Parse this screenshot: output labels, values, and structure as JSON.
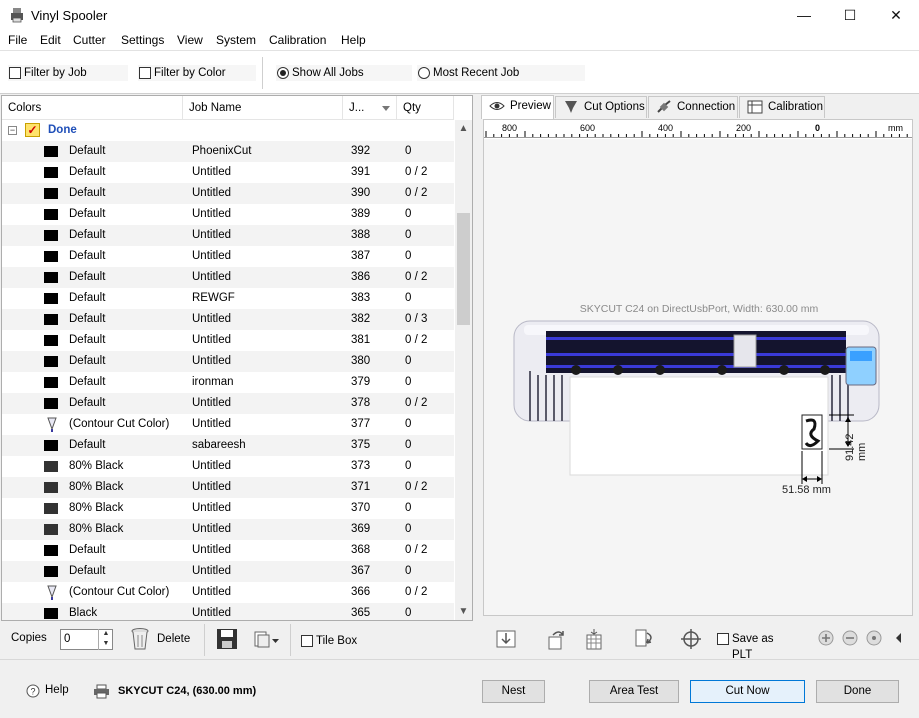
{
  "window": {
    "title": "Vinyl Spooler",
    "minimize": "—",
    "maximize": "☐",
    "close": "✕"
  },
  "menu": [
    "File",
    "Edit",
    "Cutter",
    "Settings",
    "View",
    "System",
    "Calibration",
    "Help"
  ],
  "filters": {
    "filter_by_job": "Filter by Job",
    "filter_by_color": "Filter by Color",
    "show_all_jobs": "Show All Jobs",
    "most_recent_job": "Most Recent Job",
    "selected": "show_all_jobs"
  },
  "jobs_table": {
    "columns": {
      "colors": "Colors",
      "job_name": "Job Name",
      "job_no": "J...",
      "qty": "Qty"
    },
    "group": {
      "label": "Done",
      "toggle": "−",
      "check": "✓"
    },
    "rows": [
      {
        "color": "Default",
        "swatch": "black",
        "job": "PhoenixCut",
        "no": "392",
        "qty": "0"
      },
      {
        "color": "Default",
        "swatch": "black",
        "job": "Untitled",
        "no": "391",
        "qty": "0 / 2"
      },
      {
        "color": "Default",
        "swatch": "black",
        "job": "Untitled",
        "no": "390",
        "qty": "0 / 2"
      },
      {
        "color": "Default",
        "swatch": "black",
        "job": "Untitled",
        "no": "389",
        "qty": "0"
      },
      {
        "color": "Default",
        "swatch": "black",
        "job": "Untitled",
        "no": "388",
        "qty": "0"
      },
      {
        "color": "Default",
        "swatch": "black",
        "job": "Untitled",
        "no": "387",
        "qty": "0"
      },
      {
        "color": "Default",
        "swatch": "black",
        "job": "Untitled",
        "no": "386",
        "qty": "0 / 2"
      },
      {
        "color": "Default",
        "swatch": "black",
        "job": "REWGF",
        "no": "383",
        "qty": "0"
      },
      {
        "color": "Default",
        "swatch": "black",
        "job": "Untitled",
        "no": "382",
        "qty": "0 / 3"
      },
      {
        "color": "Default",
        "swatch": "black",
        "job": "Untitled",
        "no": "381",
        "qty": "0 / 2"
      },
      {
        "color": "Default",
        "swatch": "black",
        "job": "Untitled",
        "no": "380",
        "qty": "0"
      },
      {
        "color": "Default",
        "swatch": "black",
        "job": "ironman",
        "no": "379",
        "qty": "0"
      },
      {
        "color": "Default",
        "swatch": "black",
        "job": "Untitled",
        "no": "378",
        "qty": "0 / 2"
      },
      {
        "color": "(Contour Cut Color)",
        "swatch": "pen",
        "job": "Untitled",
        "no": "377",
        "qty": "0"
      },
      {
        "color": "Default",
        "swatch": "black",
        "job": "sabareesh",
        "no": "375",
        "qty": "0"
      },
      {
        "color": "80% Black",
        "swatch": "gray",
        "job": "Untitled",
        "no": "373",
        "qty": "0"
      },
      {
        "color": "80% Black",
        "swatch": "gray",
        "job": "Untitled",
        "no": "371",
        "qty": "0 / 2"
      },
      {
        "color": "80% Black",
        "swatch": "gray",
        "job": "Untitled",
        "no": "370",
        "qty": "0"
      },
      {
        "color": "80% Black",
        "swatch": "gray",
        "job": "Untitled",
        "no": "369",
        "qty": "0"
      },
      {
        "color": "Default",
        "swatch": "black",
        "job": "Untitled",
        "no": "368",
        "qty": "0 / 2"
      },
      {
        "color": "Default",
        "swatch": "black",
        "job": "Untitled",
        "no": "367",
        "qty": "0"
      },
      {
        "color": "(Contour Cut Color)",
        "swatch": "pen",
        "job": "Untitled",
        "no": "366",
        "qty": "0 / 2"
      },
      {
        "color": "Black",
        "swatch": "black",
        "job": "Untitled",
        "no": "365",
        "qty": "0"
      }
    ]
  },
  "left_toolbar": {
    "copies_label": "Copies",
    "copies_value": "0",
    "delete_label": "Delete",
    "tile_box_label": "Tile Box"
  },
  "tabs": [
    "Preview",
    "Cut Options",
    "Connection",
    "Calibration"
  ],
  "preview": {
    "ruler_labels": [
      "800",
      "600",
      "400",
      "200",
      "0",
      "mm"
    ],
    "device_label": "SKYCUT C24 on DirectUsbPort,   Width: 630.00 mm",
    "height_dim": "91.42 mm",
    "width_dim": "51.58 mm"
  },
  "right_toolbar": {
    "save_as_plt": "Save as PLT"
  },
  "status": {
    "help_label": "Help",
    "printer_label": "SKYCUT C24,  (630.00 mm)",
    "nest": "Nest",
    "area_test": "Area Test",
    "cut_now": "Cut Now",
    "done": "Done"
  },
  "colors": {
    "accent": "#0078d7",
    "group_label": "#1f4fb8",
    "cutter_body": "#e9e9ef",
    "cutter_accent": "#3a3aa0"
  }
}
